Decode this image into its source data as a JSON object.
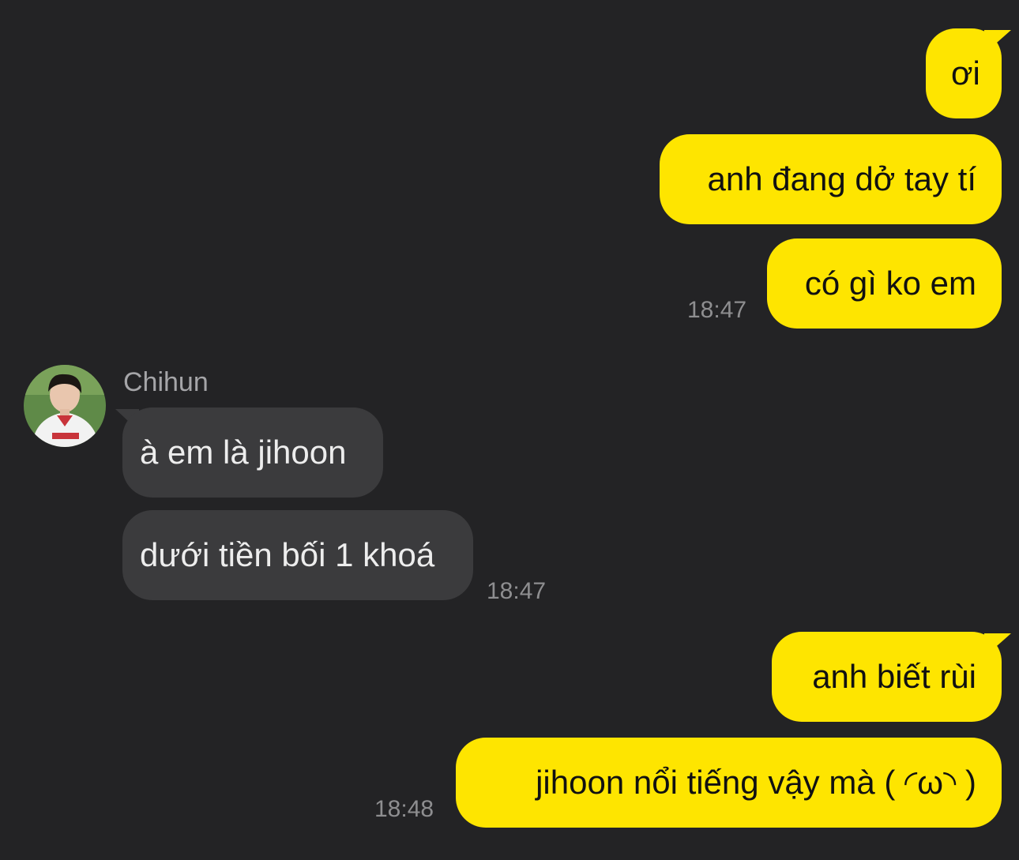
{
  "conversation": {
    "messages": [
      {
        "direction": "outgoing",
        "text": "ơi"
      },
      {
        "direction": "outgoing",
        "text": "anh đang dở tay tí"
      },
      {
        "direction": "outgoing",
        "text": "có gì ko em",
        "time": "18:47"
      },
      {
        "direction": "incoming",
        "sender": "Chihun",
        "text": "à em là jihoon"
      },
      {
        "direction": "incoming",
        "text": "dưới tiền bối 1 khoá",
        "time": "18:47"
      },
      {
        "direction": "outgoing",
        "text": "anh biết rùi"
      },
      {
        "direction": "outgoing",
        "text": "jihoon nổi tiếng vậy mà ( ◜ω◝ )",
        "time": "18:48"
      }
    ]
  },
  "contact": {
    "name": "Chihun",
    "avatar_icon": "profile-photo"
  },
  "colors": {
    "background": "#232325",
    "outgoing_bubble": "#fee500",
    "incoming_bubble": "#3b3b3d",
    "timestamp": "#8e8e90"
  }
}
